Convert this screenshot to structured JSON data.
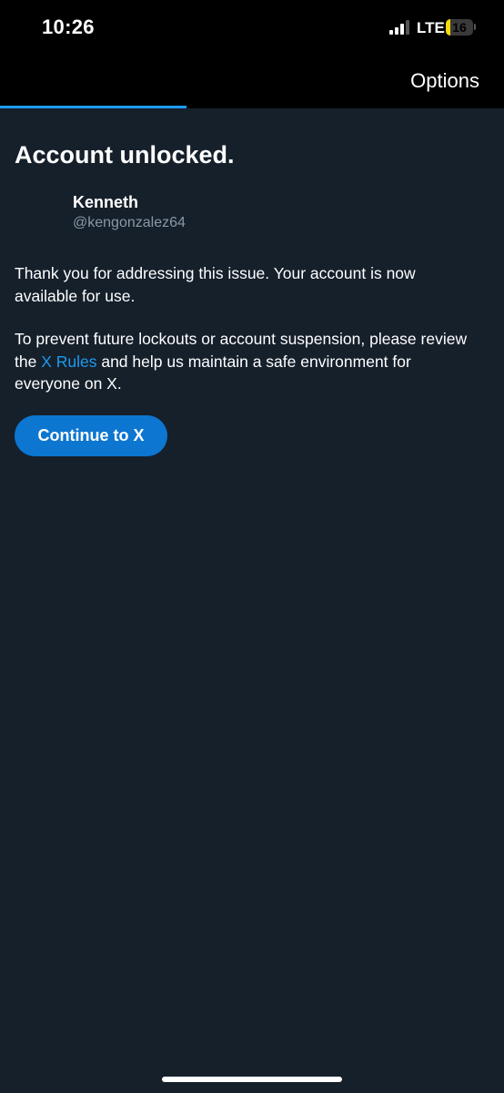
{
  "status_bar": {
    "time": "10:26",
    "network": "LTE",
    "battery_level": "16",
    "battery_fraction": 0.16,
    "signal_bars_active": 3,
    "signal_bars_total": 4
  },
  "header": {
    "options_label": "Options",
    "progress_fraction": 0.37
  },
  "page": {
    "title": "Account unlocked.",
    "user": {
      "name": "Kenneth",
      "handle": "@kengonzalez64"
    },
    "paragraph1": "Thank you for addressing this issue. Your account is now available for use.",
    "paragraph2_before": "To prevent future lockouts or account suspension, please review the ",
    "rules_link": "X Rules",
    "paragraph2_after": " and help us maintain a safe environment for everyone on X.",
    "continue_label": "Continue to X"
  },
  "colors": {
    "background": "#15202b",
    "header_background": "#000000",
    "accent": "#1d9bf0",
    "button": "#0c76d0",
    "secondary_text": "#8b98a5",
    "battery_low": "#f5d90a"
  }
}
